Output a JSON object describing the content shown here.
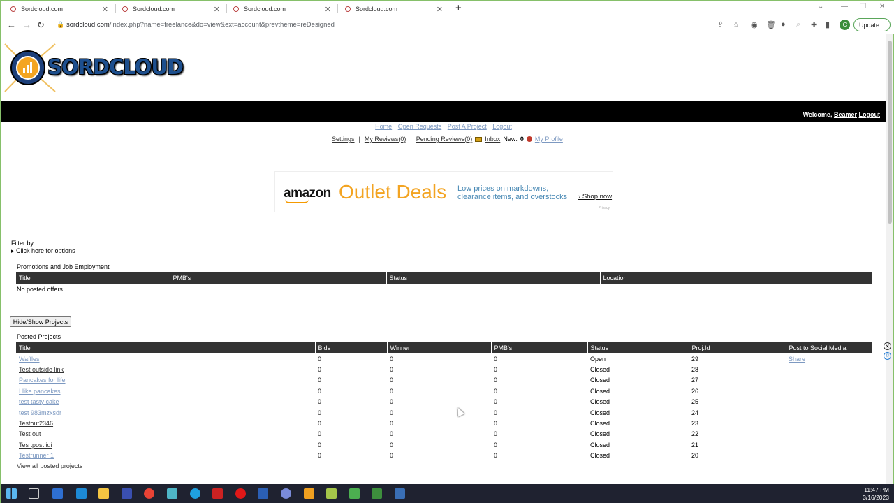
{
  "browser": {
    "tabs": [
      {
        "title": "Sordcloud.com"
      },
      {
        "title": "Sordcloud.com"
      },
      {
        "title": "Sordcloud.com"
      },
      {
        "title": "Sordcloud.com"
      }
    ],
    "url_host": "sordcloud.com",
    "url_rest": "/index.php?name=freelance&do=view&ext=account&prevtheme=reDesigned",
    "profile_initial": "C",
    "update_label": "Update"
  },
  "site": {
    "logo_text": "SORDCLOUD",
    "welcome_prefix": "Welcome, ",
    "username": "Beamer",
    "logout_label": "Logout"
  },
  "topnav": {
    "home": "Home",
    "open_requests": "Open Requests",
    "post_project": "Post A Project",
    "logout": "Logout"
  },
  "subnav": {
    "settings": "Settings",
    "my_reviews": "My Reviews(0)",
    "pending_reviews": "Pending Reviews(0)",
    "inbox": "Inbox",
    "new_label": "New:",
    "new_count": "0",
    "my_profile": "My Profile"
  },
  "ad": {
    "brand": "amazon",
    "headline": "Outlet Deals",
    "tagline": "Low prices on markdowns, clearance items, and overstocks",
    "cta": "Shop now",
    "privacy": "Privacy"
  },
  "filter": {
    "label": "Filter by:",
    "options": "Click here for options"
  },
  "promotions": {
    "title": "Promotions and Job Employment",
    "columns": [
      "Title",
      "PMB's",
      "Status",
      "Location"
    ],
    "empty": "No posted offers."
  },
  "hide_show_label": "Hide/Show Projects",
  "projects": {
    "title": "Posted Projects",
    "columns": [
      "Title",
      "Bids",
      "Winner",
      "PMB's",
      "Status",
      "Proj.Id",
      "Post to Social Media"
    ],
    "rows": [
      {
        "title": "Waffles",
        "bids": "0",
        "winner": "0",
        "pmbs": "0",
        "status": "Open",
        "id": "29",
        "social": "Share"
      },
      {
        "title": "Test outside link",
        "bids": "0",
        "winner": "0",
        "pmbs": "0",
        "status": "Closed",
        "id": "28",
        "social": ""
      },
      {
        "title": "Pancakes for life",
        "bids": "0",
        "winner": "0",
        "pmbs": "0",
        "status": "Closed",
        "id": "27",
        "social": ""
      },
      {
        "title": "I like pancakes",
        "bids": "0",
        "winner": "0",
        "pmbs": "0",
        "status": "Closed",
        "id": "26",
        "social": ""
      },
      {
        "title": "test tasty cake",
        "bids": "0",
        "winner": "0",
        "pmbs": "0",
        "status": "Closed",
        "id": "25",
        "social": ""
      },
      {
        "title": "test 983mzxsdr",
        "bids": "0",
        "winner": "0",
        "pmbs": "0",
        "status": "Closed",
        "id": "24",
        "social": ""
      },
      {
        "title": "Testout2346",
        "bids": "0",
        "winner": "0",
        "pmbs": "0",
        "status": "Closed",
        "id": "23",
        "social": ""
      },
      {
        "title": "Test out",
        "bids": "0",
        "winner": "0",
        "pmbs": "0",
        "status": "Closed",
        "id": "22",
        "social": ""
      },
      {
        "title": "Tes tpost idi",
        "bids": "0",
        "winner": "0",
        "pmbs": "0",
        "status": "Closed",
        "id": "21",
        "social": ""
      },
      {
        "title": "Testrunner 1",
        "bids": "0",
        "winner": "0",
        "pmbs": "0",
        "status": "Closed",
        "id": "20",
        "social": ""
      }
    ],
    "view_all": "View all posted projects"
  },
  "taskbar": {
    "time": "11:47 PM",
    "date": "3/16/2023"
  }
}
